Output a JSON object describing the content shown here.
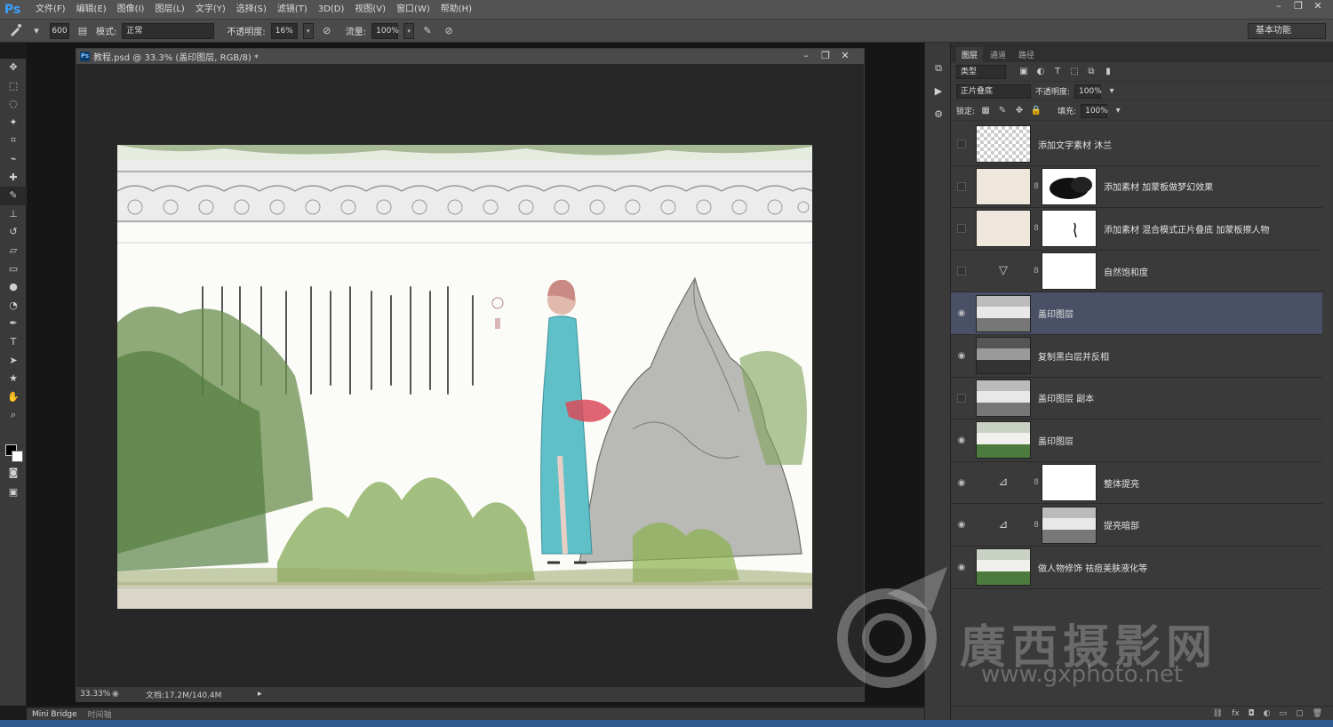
{
  "app": {
    "logo": "Ps"
  },
  "menu": [
    "文件(F)",
    "编辑(E)",
    "图像(I)",
    "图层(L)",
    "文字(Y)",
    "选择(S)",
    "滤镜(T)",
    "3D(D)",
    "视图(V)",
    "窗口(W)",
    "帮助(H)"
  ],
  "window_controls": {
    "minimize": "–",
    "restore": "❐",
    "close": "✕"
  },
  "options": {
    "brush_size": "600",
    "mode_label": "模式:",
    "mode_value": "正常",
    "opacity_label": "不透明度:",
    "opacity_value": "16%",
    "flow_label": "流量:",
    "flow_value": "100%",
    "workspace": "基本功能"
  },
  "document": {
    "title": "教程.psd @ 33.3% (盖印图层, RGB/8) *",
    "zoom": "33.33%",
    "doc_size": "文档:17.2M/140.4M"
  },
  "bottom_tabs": {
    "bridge": "Mini Bridge",
    "timeline": "时间轴"
  },
  "panel": {
    "tabs": [
      "图层",
      "通道",
      "路径"
    ],
    "kind_filter": "类型",
    "blend_mode": "正片叠底",
    "opacity_label": "不透明度:",
    "opacity_value": "100%",
    "lock_label": "锁定:",
    "fill_label": "填充:",
    "fill_value": "100%"
  },
  "layers": [
    {
      "name": "添加文字素材  沐兰",
      "visible": false,
      "thumb": "checker",
      "mask": false,
      "adj": ""
    },
    {
      "name": "添加素材  加蒙板做梦幻效果",
      "visible": false,
      "thumb": "paper",
      "mask": "cloud",
      "adj": ""
    },
    {
      "name": "添加素材  混合模式正片叠底  加蒙板擦人物",
      "visible": false,
      "thumb": "paper",
      "mask": "figure",
      "adj": ""
    },
    {
      "name": "自然饱和度",
      "visible": false,
      "thumb": "",
      "mask": "white",
      "adj": "vibrance"
    },
    {
      "name": "盖印图层",
      "visible": true,
      "thumb": "scene",
      "mask": false,
      "adj": "",
      "selected": true
    },
    {
      "name": "复制黑白层并反相",
      "visible": true,
      "thumb": "dark",
      "mask": false,
      "adj": ""
    },
    {
      "name": "盖印图层 副本",
      "visible": false,
      "thumb": "gray",
      "mask": false,
      "adj": ""
    },
    {
      "name": "盖印图层",
      "visible": true,
      "thumb": "color",
      "mask": false,
      "adj": ""
    },
    {
      "name": "整体提亮",
      "visible": true,
      "thumb": "",
      "mask": "white",
      "adj": "curves"
    },
    {
      "name": "提亮暗部",
      "visible": true,
      "thumb": "",
      "mask": "gray",
      "adj": "curves"
    },
    {
      "name": "做人物修饰  祛痘美肤液化等",
      "visible": true,
      "thumb": "color",
      "mask": false,
      "adj": ""
    }
  ],
  "watermark": {
    "text": "廣西摄影网",
    "url": "www.gxphoto.net"
  },
  "icons": {
    "brush": "brush-icon",
    "eye": "eye-icon",
    "chain": "link-icon"
  }
}
